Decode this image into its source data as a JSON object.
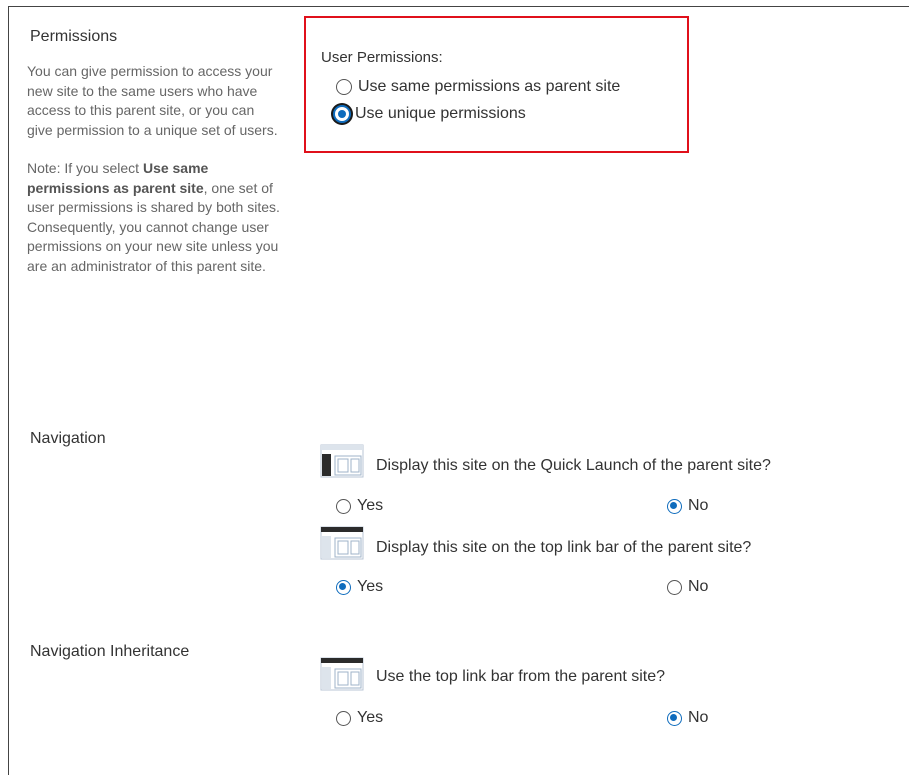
{
  "permissions": {
    "title": "Permissions",
    "desc1": "You can give permission to access your new site to the same users who have access to this parent site, or you can give permission to a unique set of users.",
    "note_prefix": "Note: If you select ",
    "note_bold": "Use same permissions as parent site",
    "note_suffix": ", one set of user permissions is shared by both sites. Consequently, you cannot change user permissions on your new site unless you are an administrator of this parent site.",
    "user_permissions_label": "User Permissions:",
    "option_same": "Use same permissions as parent site",
    "option_unique": "Use unique permissions",
    "selected": "unique"
  },
  "navigation": {
    "title": "Navigation",
    "quick_launch_question": "Display this site on the Quick Launch of the parent site?",
    "quick_launch_selected": "No",
    "top_link_question": "Display this site on the top link bar of the parent site?",
    "top_link_selected": "Yes",
    "yes_label": "Yes",
    "no_label": "No"
  },
  "inheritance": {
    "title": "Navigation Inheritance",
    "question": "Use the top link bar from the parent site?",
    "selected": "No",
    "yes_label": "Yes",
    "no_label": "No"
  },
  "colors": {
    "highlight_border": "#e0101b",
    "radio_accent": "#0f6cbd"
  }
}
